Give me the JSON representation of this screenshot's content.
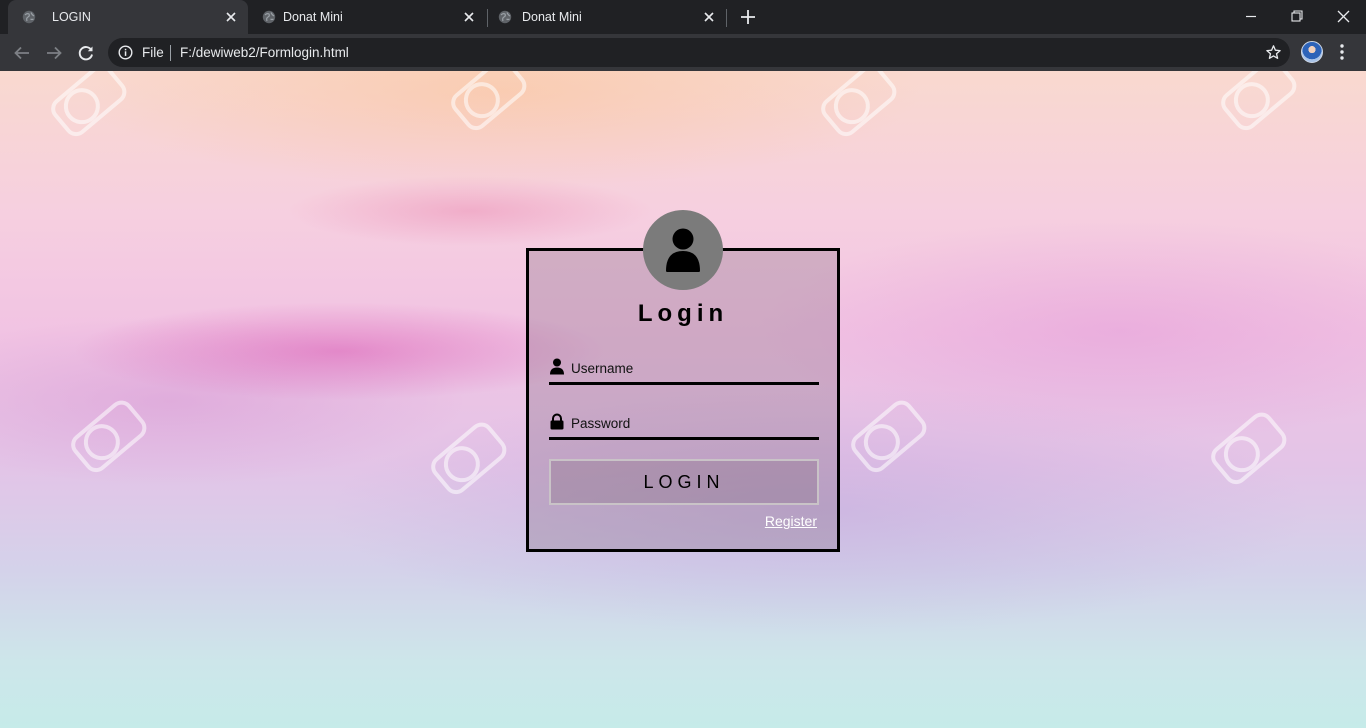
{
  "browser": {
    "tabs": [
      {
        "title": "LOGIN",
        "active": true
      },
      {
        "title": "Donat Mini",
        "active": false
      },
      {
        "title": "Donat Mini",
        "active": false
      }
    ],
    "omnibox": {
      "scheme_label": "File",
      "url": "F:/dewiweb2/Formlogin.html"
    },
    "icons": {
      "favicon": "globe-icon",
      "close": "close-icon",
      "new_tab": "plus-icon",
      "back": "back-arrow-icon",
      "forward": "forward-arrow-icon",
      "reload": "reload-icon",
      "info": "info-icon",
      "bookmark": "star-icon",
      "profile": "profile-avatar",
      "menu": "kebab-menu-icon"
    },
    "colors": {
      "frame": "#202124",
      "toolbar": "#35363a",
      "text": "#e8eaed"
    }
  },
  "page": {
    "login": {
      "title": "Login",
      "username_placeholder": "Username",
      "password_placeholder": "Password",
      "button_label": "LOGIN",
      "register_link": "Register"
    },
    "colors": {
      "card_border": "#000000",
      "avatar_bg": "#7b7b7b",
      "link": "#ffffff"
    }
  }
}
